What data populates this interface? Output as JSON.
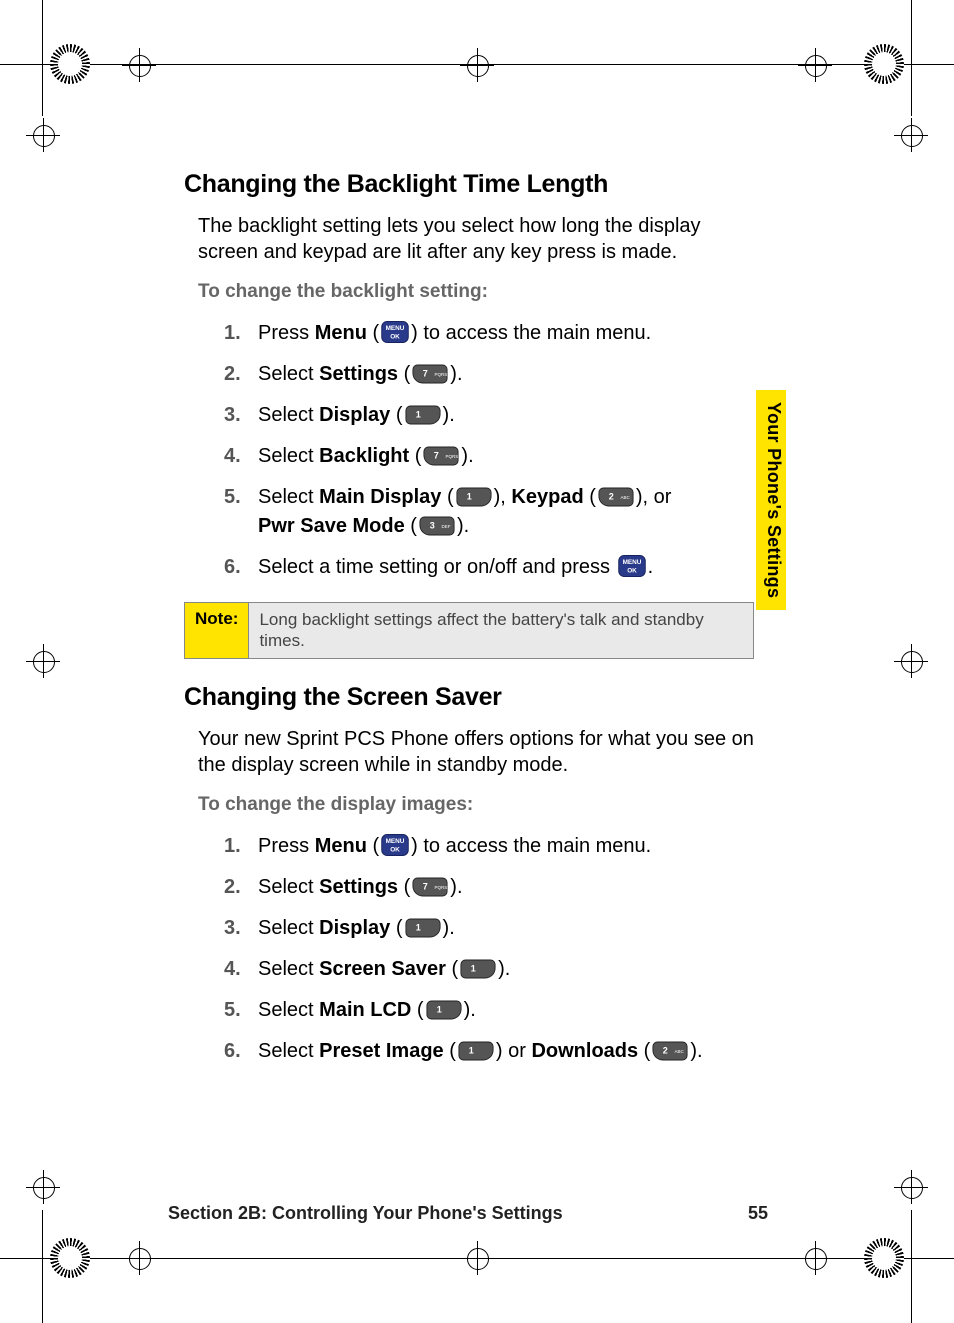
{
  "side_tab": "Your Phone's Settings",
  "footer": {
    "section": "Section 2B: Controlling Your Phone's Settings",
    "page": "55"
  },
  "section1": {
    "title": "Changing the Backlight Time Length",
    "intro": "The backlight setting lets you select how long the display screen and keypad are lit after any key press is made.",
    "lead": "To change the backlight setting:",
    "steps": {
      "s1a": "Press ",
      "s1b": "Menu",
      "s1c": " (",
      "s1d": ") to access the main menu.",
      "s2a": "Select ",
      "s2b": "Settings",
      "s2c": " (",
      "s2d": ").",
      "s3a": "Select ",
      "s3b": "Display",
      "s3c": " (",
      "s3d": ").",
      "s4a": "Select ",
      "s4b": "Backlight",
      "s4c": " (",
      "s4d": ").",
      "s5a": "Select ",
      "s5b": "Main Display",
      "s5c": " (",
      "s5d": "), ",
      "s5e": "Keypad",
      "s5f": " (",
      "s5g": "), or",
      "s5h": "Pwr Save Mode",
      "s5i": " (",
      "s5j": ").",
      "s6a": "Select a time setting or on/off and press ",
      "s6b": "."
    },
    "note": {
      "label": "Note:",
      "body": "Long backlight settings affect the battery's talk and standby times."
    }
  },
  "section2": {
    "title": "Changing the Screen Saver",
    "intro": "Your new Sprint PCS Phone offers options for what you see on the display screen while in standby mode.",
    "lead": "To change the display images:",
    "steps": {
      "s1a": "Press ",
      "s1b": "Menu",
      "s1c": " (",
      "s1d": ") to access the main menu.",
      "s2a": "Select ",
      "s2b": "Settings",
      "s2c": " (",
      "s2d": ").",
      "s3a": "Select ",
      "s3b": "Display",
      "s3c": " (",
      "s3d": ").",
      "s4a": "Select ",
      "s4b": "Screen Saver",
      "s4c": " (",
      "s4d": ").",
      "s5a": "Select ",
      "s5b": "Main LCD",
      "s5c": " (",
      "s5d": ").",
      "s6a": "Select ",
      "s6b": "Preset Image",
      "s6c": " (",
      "s6d": ") or ",
      "s6e": "Downloads",
      "s6f": " (",
      "s6g": ")."
    }
  },
  "keys": {
    "menu_ok_top": "MENU",
    "menu_ok_bot": "OK",
    "k1": "1",
    "k2": "2",
    "k2s": "ABC",
    "k3": "3",
    "k3s": "DEF",
    "k7": "7",
    "k7s": "PQRS"
  }
}
